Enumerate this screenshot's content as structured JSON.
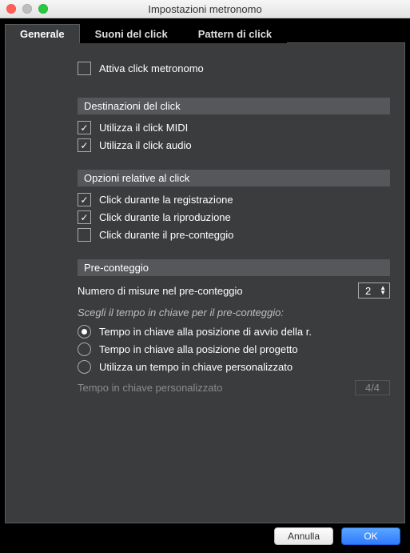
{
  "window": {
    "title": "Impostazioni metronomo"
  },
  "tabs": {
    "general": "Generale",
    "sounds": "Suoni del click",
    "patterns": "Pattern di click"
  },
  "activate": {
    "label": "Attiva click metronomo",
    "checked": false
  },
  "sections": {
    "destinations": {
      "title": "Destinazioni del click",
      "midi": {
        "label": "Utilizza il click MIDI",
        "checked": true
      },
      "audio": {
        "label": "Utilizza il click audio",
        "checked": true
      }
    },
    "options": {
      "title": "Opzioni relative al click",
      "record": {
        "label": "Click durante la registrazione",
        "checked": true
      },
      "play": {
        "label": "Click durante la riproduzione",
        "checked": true
      },
      "precount": {
        "label": "Click durante il pre-conteggio",
        "checked": false
      }
    },
    "precount": {
      "title": "Pre-conteggio",
      "bars_label": "Numero di misure nel pre-conteggio",
      "bars_value": "2",
      "note": "Scegli il tempo in chiave per il pre-conteggio:",
      "radio": {
        "rec_pos": {
          "label": "Tempo in chiave alla posizione di avvio della r.",
          "checked": true
        },
        "proj_pos": {
          "label": "Tempo in chiave alla posizione del progetto",
          "checked": false
        },
        "custom": {
          "label": "Utilizza un tempo in chiave personalizzato",
          "checked": false
        }
      },
      "custom_label": "Tempo in chiave personalizzato",
      "custom_value": "4/4"
    }
  },
  "buttons": {
    "cancel": "Annulla",
    "ok": "OK"
  }
}
